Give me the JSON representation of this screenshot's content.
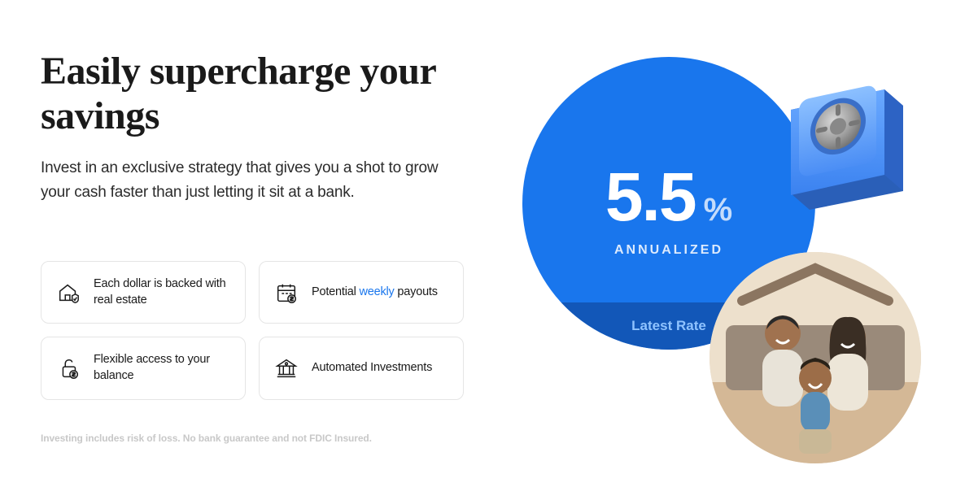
{
  "headline": "Easily supercharge your savings",
  "subtext": "Invest in an exclusive strategy that gives you a shot to grow your cash faster than just letting it sit at a bank.",
  "features": [
    {
      "text": "Each dollar is backed with real estate",
      "icon": "house-shield-icon"
    },
    {
      "pre": "Potential ",
      "accent": "weekly",
      "post": " payouts",
      "icon": "calendar-dollar-icon"
    },
    {
      "text": "Flexible access to your balance",
      "icon": "unlock-dollar-icon"
    },
    {
      "text": "Automated Investments",
      "icon": "bank-icon"
    }
  ],
  "disclaimer": "Investing includes risk of loss.  No bank guarantee and not FDIC Insured.",
  "rate": {
    "value": "5.5",
    "percent": "%",
    "label": "ANNUALIZED",
    "band": "Latest Rate"
  }
}
